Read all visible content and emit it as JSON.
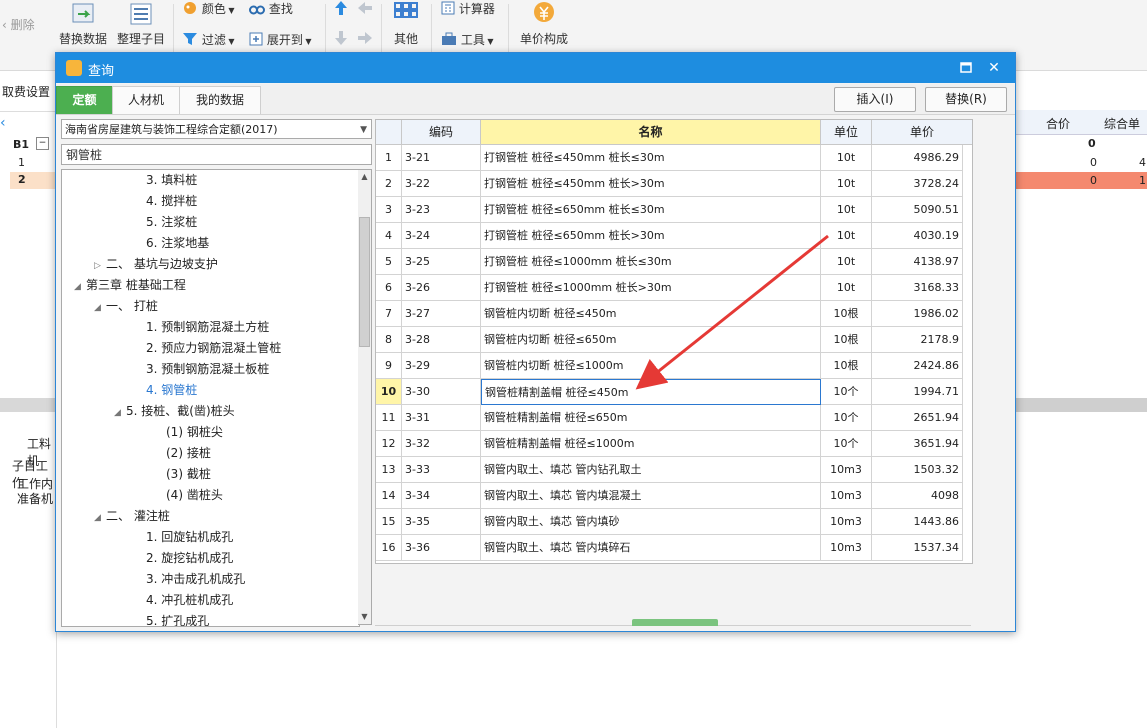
{
  "app": {
    "ribbon": {
      "delete_label": "删除",
      "replace_data_label": "替换数据",
      "organize_label": "整理子目",
      "color_label": "颜色",
      "find_label": "查找",
      "filter_label": "过滤",
      "expand_label": "展开到",
      "other_label": "其他",
      "calculator_label": "计算器",
      "tools_label": "工具",
      "unit_price_label": "单价构成"
    },
    "fee_settings_label": "取费设置",
    "bg_table": {
      "header_total": "合价",
      "header_comprehensive": "综合单",
      "row0_total": "0",
      "row1_total": "0",
      "row1_comp": "4",
      "row2_total": "0",
      "row2_comp": "1"
    },
    "bg_left": {
      "b1_label": "B1",
      "row1": "1",
      "row2": "2",
      "material_label": "工料机",
      "sub_work_label": "子目工作",
      "work_content": "工作内",
      "prep_label": "准备机"
    }
  },
  "dialog": {
    "title": "查询",
    "tabs": [
      "定额",
      "人材机",
      "我的数据"
    ],
    "insert_label": "插入(I)",
    "replace_label": "替换(R)",
    "library_name": "海南省房屋建筑与装饰工程综合定额(2017)",
    "search_value": "钢管桩",
    "tree": [
      {
        "label": "3. 填料桩",
        "indent": 4,
        "expander": ""
      },
      {
        "label": "4. 搅拌桩",
        "indent": 4,
        "expander": ""
      },
      {
        "label": "5. 注浆桩",
        "indent": 4,
        "expander": ""
      },
      {
        "label": "6. 注浆地基",
        "indent": 4,
        "expander": ""
      },
      {
        "label": "二、 基坑与边坡支护",
        "indent": 2,
        "expander": "▷"
      },
      {
        "label": "第三章 桩基础工程",
        "indent": 1,
        "expander": "◢"
      },
      {
        "label": "一、 打桩",
        "indent": 2,
        "expander": "◢"
      },
      {
        "label": "1. 预制钢筋混凝土方桩",
        "indent": 4,
        "expander": ""
      },
      {
        "label": "2. 预应力钢筋混凝土管桩",
        "indent": 4,
        "expander": ""
      },
      {
        "label": "3. 预制钢筋混凝土板桩",
        "indent": 4,
        "expander": ""
      },
      {
        "label": "4. 钢管桩",
        "indent": 4,
        "expander": "",
        "selected": true
      },
      {
        "label": "5. 接桩、截(凿)桩头",
        "indent": 3,
        "expander": "◢"
      },
      {
        "label": "(1) 钢桩尖",
        "indent": 5,
        "expander": ""
      },
      {
        "label": "(2) 接桩",
        "indent": 5,
        "expander": ""
      },
      {
        "label": "(3) 截桩",
        "indent": 5,
        "expander": ""
      },
      {
        "label": "(4) 凿桩头",
        "indent": 5,
        "expander": ""
      },
      {
        "label": "二、 灌注桩",
        "indent": 2,
        "expander": "◢"
      },
      {
        "label": "1. 回旋钻机成孔",
        "indent": 4,
        "expander": ""
      },
      {
        "label": "2. 旋挖钻机成孔",
        "indent": 4,
        "expander": ""
      },
      {
        "label": "3. 冲击成孔机成孔",
        "indent": 4,
        "expander": ""
      },
      {
        "label": "4. 冲孔桩机成孔",
        "indent": 4,
        "expander": ""
      },
      {
        "label": "5. 扩孔成孔",
        "indent": 4,
        "expander": ""
      }
    ],
    "grid": {
      "headers": [
        "编码",
        "名称",
        "单位",
        "单价"
      ],
      "current_row": 10,
      "rows": [
        {
          "no": "1",
          "code": "3-21",
          "name": "打钢管桩 桩径≤450mm 桩长≤30m",
          "unit": "10t",
          "price": "4986.29"
        },
        {
          "no": "2",
          "code": "3-22",
          "name": "打钢管桩 桩径≤450mm 桩长>30m",
          "unit": "10t",
          "price": "3728.24"
        },
        {
          "no": "3",
          "code": "3-23",
          "name": "打钢管桩 桩径≤650mm 桩长≤30m",
          "unit": "10t",
          "price": "5090.51"
        },
        {
          "no": "4",
          "code": "3-24",
          "name": "打钢管桩 桩径≤650mm 桩长>30m",
          "unit": "10t",
          "price": "4030.19"
        },
        {
          "no": "5",
          "code": "3-25",
          "name": "打钢管桩 桩径≤1000mm 桩长≤30m",
          "unit": "10t",
          "price": "4138.97"
        },
        {
          "no": "6",
          "code": "3-26",
          "name": "打钢管桩 桩径≤1000mm 桩长>30m",
          "unit": "10t",
          "price": "3168.33"
        },
        {
          "no": "7",
          "code": "3-27",
          "name": "钢管桩内切断 桩径≤450m",
          "unit": "10根",
          "price": "1986.02"
        },
        {
          "no": "8",
          "code": "3-28",
          "name": "钢管桩内切断 桩径≤650m",
          "unit": "10根",
          "price": "2178.9"
        },
        {
          "no": "9",
          "code": "3-29",
          "name": "钢管桩内切断 桩径≤1000m",
          "unit": "10根",
          "price": "2424.86"
        },
        {
          "no": "10",
          "code": "3-30",
          "name": "钢管桩精割盖帽 桩径≤450m",
          "unit": "10个",
          "price": "1994.71"
        },
        {
          "no": "11",
          "code": "3-31",
          "name": "钢管桩精割盖帽 桩径≤650m",
          "unit": "10个",
          "price": "2651.94"
        },
        {
          "no": "12",
          "code": "3-32",
          "name": "钢管桩精割盖帽 桩径≤1000m",
          "unit": "10个",
          "price": "3651.94"
        },
        {
          "no": "13",
          "code": "3-33",
          "name": "钢管内取土、填芯 管内钻孔取土",
          "unit": "10m3",
          "price": "1503.32"
        },
        {
          "no": "14",
          "code": "3-34",
          "name": "钢管内取土、填芯 管内填混凝土",
          "unit": "10m3",
          "price": "4098"
        },
        {
          "no": "15",
          "code": "3-35",
          "name": "钢管内取土、填芯 管内填砂",
          "unit": "10m3",
          "price": "1443.86"
        },
        {
          "no": "16",
          "code": "3-36",
          "name": "钢管内取土、填芯 管内填碎石",
          "unit": "10m3",
          "price": "1537.34"
        }
      ]
    }
  },
  "colors": {
    "titlebar": "#1e8de0",
    "active_tab": "#4caf50",
    "header_highlight": "#fff5a8",
    "arrow": "#e53935",
    "selected_row_bg": "#f4896f"
  }
}
